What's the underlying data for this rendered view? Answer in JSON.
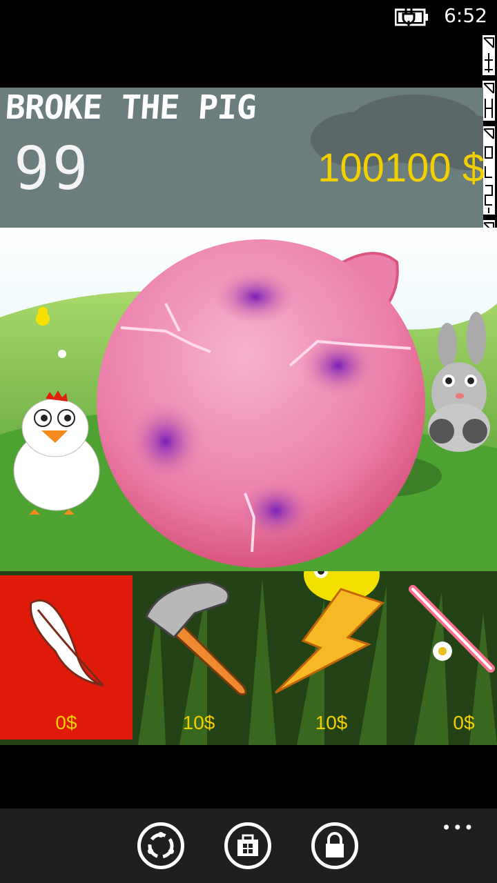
{
  "status": {
    "time": "6:52"
  },
  "side_strip": {
    "labels": [
      "",
      "",
      "",
      "",
      "",
      "",
      ""
    ]
  },
  "game": {
    "title": "BROKE THE PIG",
    "hits_remaining": "99",
    "money": "100100 $"
  },
  "tools": [
    {
      "name": "feather",
      "price": "0$",
      "selected": true
    },
    {
      "name": "hammer",
      "price": "10$",
      "selected": false
    },
    {
      "name": "lightning",
      "price": "10$",
      "selected": false
    },
    {
      "name": "lightsaber",
      "price": "0$",
      "selected": false
    }
  ],
  "nav": {
    "more_label": "•••"
  },
  "colors": {
    "header_bg": "#6b7d7d",
    "money": "#f2d000",
    "selected_tool": "#e01a0b",
    "pig": "#ea7fa7"
  }
}
